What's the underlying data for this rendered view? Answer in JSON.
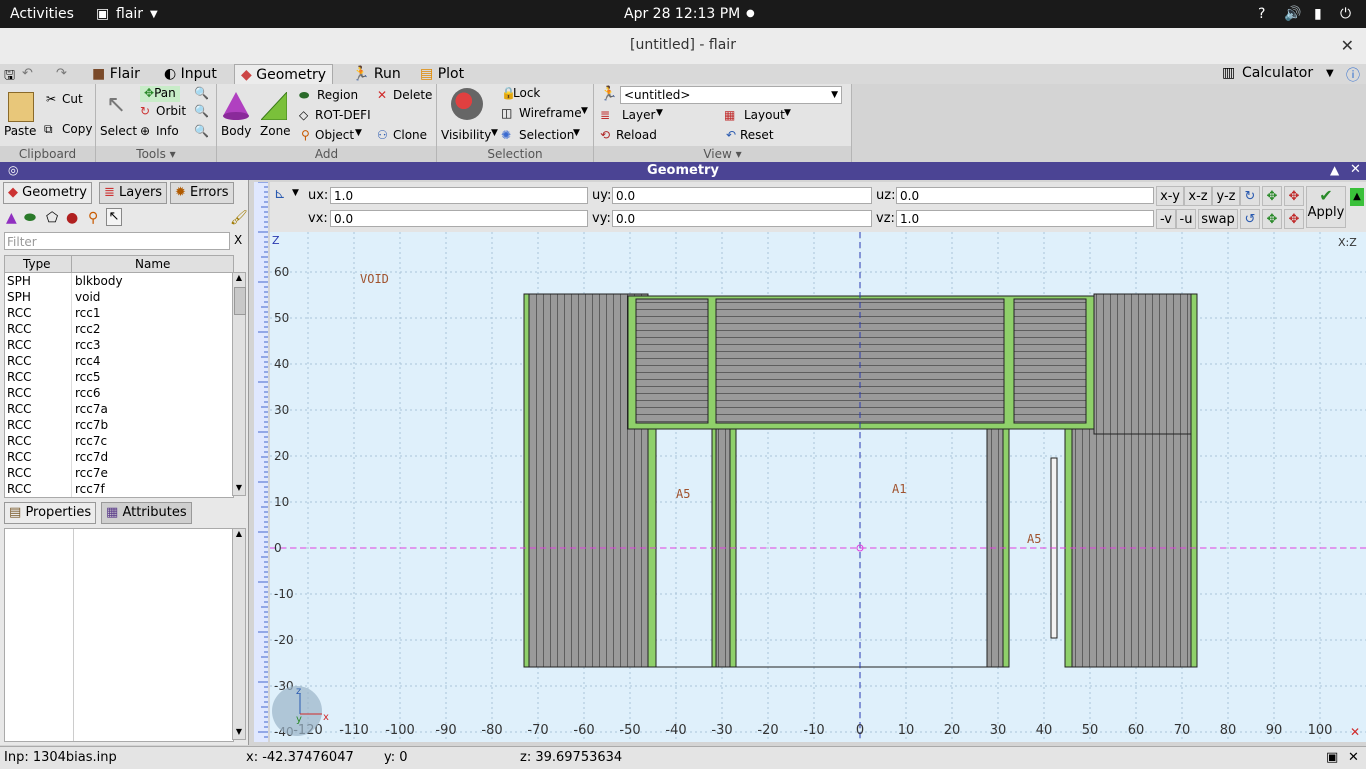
{
  "system": {
    "activities": "Activities",
    "app_menu": "flair",
    "clock": "Apr 28  12:13 PM",
    "icons": [
      "help-icon",
      "volume-icon",
      "battery-icon",
      "power-icon"
    ]
  },
  "window": {
    "title": "[untitled] - flair"
  },
  "tabs": [
    {
      "label": "Flair",
      "icon": "flair-icon"
    },
    {
      "label": "Input",
      "icon": "input-icon"
    },
    {
      "label": "Geometry",
      "icon": "geometry-icon",
      "active": true
    },
    {
      "label": "Run",
      "icon": "run-icon"
    },
    {
      "label": "Plot",
      "icon": "plot-icon"
    }
  ],
  "calculator": "Calculator",
  "ribbon": {
    "clipboard": {
      "label": "Clipboard",
      "paste": "Paste",
      "cut": "Cut",
      "copy": "Copy"
    },
    "tools": {
      "label": "Tools",
      "select": "Select",
      "pan": "Pan",
      "orbit": "Orbit",
      "info": "Info"
    },
    "add": {
      "label": "Add",
      "body": "Body",
      "zone": "Zone",
      "region": "Region",
      "rotdefi": "ROT-DEFI",
      "object": "Object",
      "delete": "Delete",
      "clone": "Clone"
    },
    "selection": {
      "label": "Selection",
      "visibility": "Visibility",
      "lock": "Lock",
      "wireframe": "Wireframe",
      "selection": "Selection"
    },
    "view": {
      "label": "View",
      "combo": "<untitled>",
      "layer": "Layer",
      "layout": "Layout",
      "reload": "Reload",
      "reset": "Reset"
    }
  },
  "geometry_title": "Geometry",
  "left": {
    "tabs": [
      "Geometry",
      "Layers",
      "Errors"
    ],
    "filter_placeholder": "Filter",
    "columns": [
      "Type",
      "Name"
    ],
    "rows": [
      [
        "SPH",
        "blkbody"
      ],
      [
        "SPH",
        "void"
      ],
      [
        "RCC",
        "rcc1"
      ],
      [
        "RCC",
        "rcc2"
      ],
      [
        "RCC",
        "rcc3"
      ],
      [
        "RCC",
        "rcc4"
      ],
      [
        "RCC",
        "rcc5"
      ],
      [
        "RCC",
        "rcc6"
      ],
      [
        "RCC",
        "rcc7a"
      ],
      [
        "RCC",
        "rcc7b"
      ],
      [
        "RCC",
        "rcc7c"
      ],
      [
        "RCC",
        "rcc7d"
      ],
      [
        "RCC",
        "rcc7e"
      ],
      [
        "RCC",
        "rcc7f"
      ]
    ],
    "prop_tabs": [
      "Properties",
      "Attributes"
    ]
  },
  "viewport": {
    "ux": "1.0",
    "uy": "0.0",
    "uz": "0.0",
    "vx": "0.0",
    "vy": "0.0",
    "vz": "1.0",
    "labels": {
      "ux": "ux:",
      "uy": "uy:",
      "uz": "uz:",
      "vx": "vx:",
      "vy": "vy:",
      "vz": "vz:"
    },
    "buttons": [
      "x-y",
      "x-z",
      "y-z",
      "-v",
      "-u",
      "swap"
    ],
    "apply": "Apply"
  },
  "plot": {
    "axis_z": "Z",
    "axis_corner": "X:Z",
    "x_ticks": [
      "-120",
      "-110",
      "-100",
      "-90",
      "-80",
      "-70",
      "-60",
      "-50",
      "-40",
      "-30",
      "-20",
      "-10",
      "0",
      "10",
      "20",
      "30",
      "40",
      "50",
      "60",
      "70",
      "80",
      "90",
      "100"
    ],
    "y_ticks": [
      "60",
      "50",
      "40",
      "30",
      "20",
      "10",
      "0",
      "-10",
      "-20",
      "-30",
      "-40"
    ],
    "region_labels": {
      "void": "VOID",
      "a5_left": "A5",
      "a1": "A1",
      "a5_right": "A5"
    },
    "orient_x": "x",
    "orient_y": "y",
    "orient_z": "z"
  },
  "status": {
    "inp": "Inp: 1304bias.inp",
    "x": "x: -42.37476047",
    "y": "y: 0",
    "z": "z: 39.69753634"
  }
}
